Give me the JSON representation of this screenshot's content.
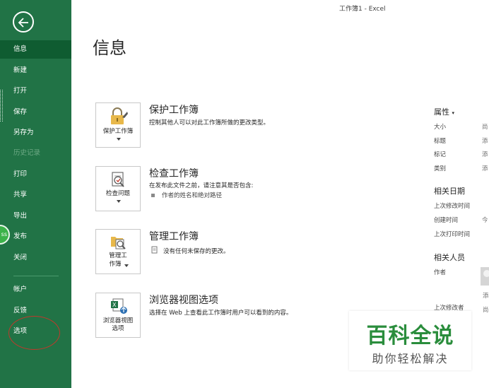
{
  "window": {
    "title": "工作簿1  -  Excel"
  },
  "sidebar": {
    "items": [
      {
        "label": "信息"
      },
      {
        "label": "新建"
      },
      {
        "label": "打开"
      },
      {
        "label": "保存"
      },
      {
        "label": "另存为"
      },
      {
        "label": "历史记录"
      },
      {
        "label": "打印"
      },
      {
        "label": "共享"
      },
      {
        "label": "导出"
      },
      {
        "label": "发布"
      },
      {
        "label": "关闭"
      },
      {
        "label": "帐户"
      },
      {
        "label": "反馈"
      },
      {
        "label": "选项"
      }
    ],
    "active": "信息",
    "badge": "ss"
  },
  "page": {
    "title": "信息"
  },
  "sections": [
    {
      "button_label_1": "保护工作簿",
      "title": "保护工作簿",
      "desc": "控制其他人可以对此工作簿所做的更改类型。"
    },
    {
      "button_label_1": "检查问题",
      "title": "检查工作簿",
      "desc": "在发布此文件之前，请注意其是否包含:",
      "bullet": "作者的姓名和绝对路径"
    },
    {
      "button_label_1": "管理工",
      "button_label_2": "作簿",
      "title": "管理工作簿",
      "desc": "没有任何未保存的更改。"
    },
    {
      "button_label_1": "浏览器视图",
      "button_label_2": "选项",
      "title": "浏览器视图选项",
      "desc": "选择在 Web 上查看此工作簿时用户可以看到的内容。"
    }
  ],
  "properties": {
    "heading": "属性",
    "rows": [
      {
        "label": "大小",
        "value": "尚"
      },
      {
        "label": "标题",
        "value": "添"
      },
      {
        "label": "标记",
        "value": "添"
      },
      {
        "label": "类别",
        "value": "添"
      }
    ],
    "dates_heading": "相关日期",
    "dates": [
      {
        "label": "上次修改时间",
        "value": ""
      },
      {
        "label": "创建时间",
        "value": "今"
      },
      {
        "label": "上次打印时间",
        "value": ""
      }
    ],
    "people_heading": "相关人员",
    "author_label": "作者",
    "author_value": "添",
    "last_modified_by_label": "上次修改者",
    "last_modified_by_value": "尚"
  },
  "watermark": {
    "main": "百科全说",
    "sub": "助你轻松解决"
  },
  "colors": {
    "sidebar": "#217346",
    "active": "#0f5c31",
    "accent": "#2a8d3c"
  }
}
